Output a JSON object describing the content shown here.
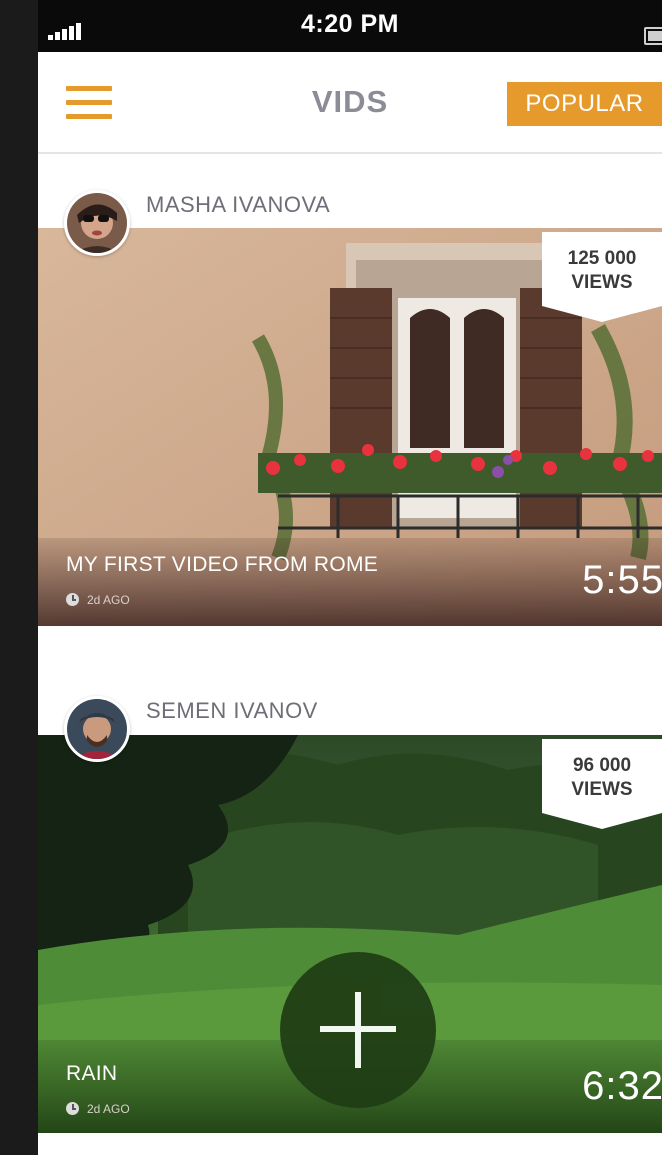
{
  "status_bar": {
    "time": "4:20 PM"
  },
  "header": {
    "title": "VIDS",
    "menu_icon": "hamburger-menu-icon",
    "popular_label": "POPULAR"
  },
  "colors": {
    "accent": "#e79a2c",
    "title_gray": "#8c8c96"
  },
  "feed": [
    {
      "author": "MASHA IVANOVA",
      "views_count": "125 000",
      "views_label": "VIEWS",
      "title": "MY FIRST VIDEO FROM ROME",
      "age": "2d AGO",
      "duration": "5:55"
    },
    {
      "author": "SEMEN IVANOV",
      "views_count": "96 000",
      "views_label": "VIEWS",
      "title": "RAIN",
      "age": "2d AGO",
      "duration": "6:32"
    }
  ],
  "add_button": {
    "icon": "plus-icon"
  }
}
